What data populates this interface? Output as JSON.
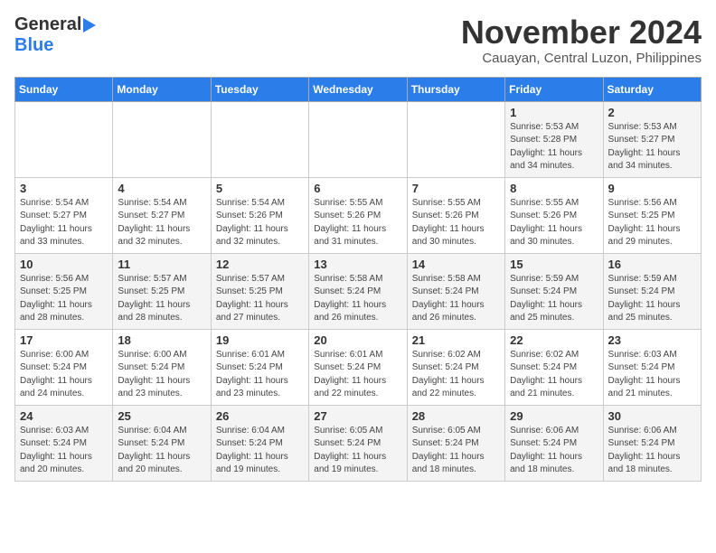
{
  "logo": {
    "line1": "General",
    "line2": "Blue"
  },
  "title": "November 2024",
  "location": "Cauayan, Central Luzon, Philippines",
  "days_header": [
    "Sunday",
    "Monday",
    "Tuesday",
    "Wednesday",
    "Thursday",
    "Friday",
    "Saturday"
  ],
  "weeks": [
    [
      {
        "day": "",
        "info": ""
      },
      {
        "day": "",
        "info": ""
      },
      {
        "day": "",
        "info": ""
      },
      {
        "day": "",
        "info": ""
      },
      {
        "day": "",
        "info": ""
      },
      {
        "day": "1",
        "info": "Sunrise: 5:53 AM\nSunset: 5:28 PM\nDaylight: 11 hours\nand 34 minutes."
      },
      {
        "day": "2",
        "info": "Sunrise: 5:53 AM\nSunset: 5:27 PM\nDaylight: 11 hours\nand 34 minutes."
      }
    ],
    [
      {
        "day": "3",
        "info": "Sunrise: 5:54 AM\nSunset: 5:27 PM\nDaylight: 11 hours\nand 33 minutes."
      },
      {
        "day": "4",
        "info": "Sunrise: 5:54 AM\nSunset: 5:27 PM\nDaylight: 11 hours\nand 32 minutes."
      },
      {
        "day": "5",
        "info": "Sunrise: 5:54 AM\nSunset: 5:26 PM\nDaylight: 11 hours\nand 32 minutes."
      },
      {
        "day": "6",
        "info": "Sunrise: 5:55 AM\nSunset: 5:26 PM\nDaylight: 11 hours\nand 31 minutes."
      },
      {
        "day": "7",
        "info": "Sunrise: 5:55 AM\nSunset: 5:26 PM\nDaylight: 11 hours\nand 30 minutes."
      },
      {
        "day": "8",
        "info": "Sunrise: 5:55 AM\nSunset: 5:26 PM\nDaylight: 11 hours\nand 30 minutes."
      },
      {
        "day": "9",
        "info": "Sunrise: 5:56 AM\nSunset: 5:25 PM\nDaylight: 11 hours\nand 29 minutes."
      }
    ],
    [
      {
        "day": "10",
        "info": "Sunrise: 5:56 AM\nSunset: 5:25 PM\nDaylight: 11 hours\nand 28 minutes."
      },
      {
        "day": "11",
        "info": "Sunrise: 5:57 AM\nSunset: 5:25 PM\nDaylight: 11 hours\nand 28 minutes."
      },
      {
        "day": "12",
        "info": "Sunrise: 5:57 AM\nSunset: 5:25 PM\nDaylight: 11 hours\nand 27 minutes."
      },
      {
        "day": "13",
        "info": "Sunrise: 5:58 AM\nSunset: 5:24 PM\nDaylight: 11 hours\nand 26 minutes."
      },
      {
        "day": "14",
        "info": "Sunrise: 5:58 AM\nSunset: 5:24 PM\nDaylight: 11 hours\nand 26 minutes."
      },
      {
        "day": "15",
        "info": "Sunrise: 5:59 AM\nSunset: 5:24 PM\nDaylight: 11 hours\nand 25 minutes."
      },
      {
        "day": "16",
        "info": "Sunrise: 5:59 AM\nSunset: 5:24 PM\nDaylight: 11 hours\nand 25 minutes."
      }
    ],
    [
      {
        "day": "17",
        "info": "Sunrise: 6:00 AM\nSunset: 5:24 PM\nDaylight: 11 hours\nand 24 minutes."
      },
      {
        "day": "18",
        "info": "Sunrise: 6:00 AM\nSunset: 5:24 PM\nDaylight: 11 hours\nand 23 minutes."
      },
      {
        "day": "19",
        "info": "Sunrise: 6:01 AM\nSunset: 5:24 PM\nDaylight: 11 hours\nand 23 minutes."
      },
      {
        "day": "20",
        "info": "Sunrise: 6:01 AM\nSunset: 5:24 PM\nDaylight: 11 hours\nand 22 minutes."
      },
      {
        "day": "21",
        "info": "Sunrise: 6:02 AM\nSunset: 5:24 PM\nDaylight: 11 hours\nand 22 minutes."
      },
      {
        "day": "22",
        "info": "Sunrise: 6:02 AM\nSunset: 5:24 PM\nDaylight: 11 hours\nand 21 minutes."
      },
      {
        "day": "23",
        "info": "Sunrise: 6:03 AM\nSunset: 5:24 PM\nDaylight: 11 hours\nand 21 minutes."
      }
    ],
    [
      {
        "day": "24",
        "info": "Sunrise: 6:03 AM\nSunset: 5:24 PM\nDaylight: 11 hours\nand 20 minutes."
      },
      {
        "day": "25",
        "info": "Sunrise: 6:04 AM\nSunset: 5:24 PM\nDaylight: 11 hours\nand 20 minutes."
      },
      {
        "day": "26",
        "info": "Sunrise: 6:04 AM\nSunset: 5:24 PM\nDaylight: 11 hours\nand 19 minutes."
      },
      {
        "day": "27",
        "info": "Sunrise: 6:05 AM\nSunset: 5:24 PM\nDaylight: 11 hours\nand 19 minutes."
      },
      {
        "day": "28",
        "info": "Sunrise: 6:05 AM\nSunset: 5:24 PM\nDaylight: 11 hours\nand 18 minutes."
      },
      {
        "day": "29",
        "info": "Sunrise: 6:06 AM\nSunset: 5:24 PM\nDaylight: 11 hours\nand 18 minutes."
      },
      {
        "day": "30",
        "info": "Sunrise: 6:06 AM\nSunset: 5:24 PM\nDaylight: 11 hours\nand 18 minutes."
      }
    ]
  ]
}
